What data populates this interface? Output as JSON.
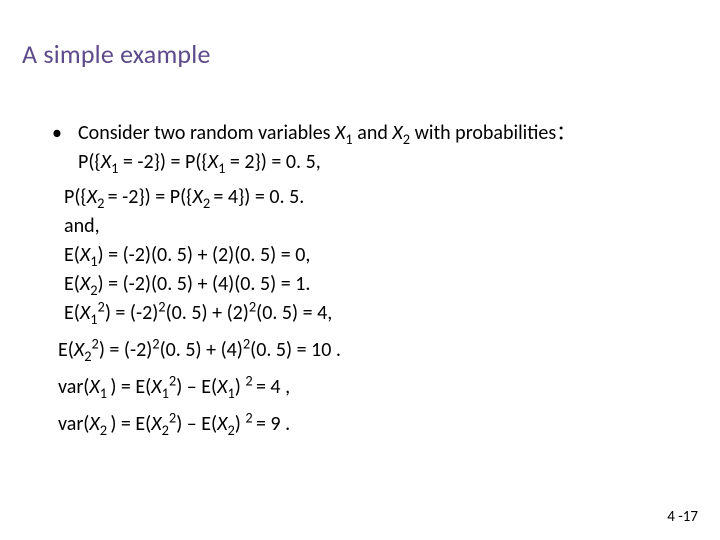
{
  "title": "A simple example",
  "bullet_dot": "•",
  "lead": {
    "part1": "Consider two random variables ",
    "x1": "X",
    "sub1": "1",
    "mid": " and  ",
    "x2": "X",
    "sub2": "2",
    "part2": " with probabilities：",
    "line2a": "P({",
    "line2x": "X",
    "line2s": "1",
    "line2b": " = -2}) = P({",
    "line2x2": "X",
    "line2s2": "1",
    "line2c": " = 2}) = 0. 5,"
  },
  "p2": {
    "a": "P({",
    "x": "X",
    "s": "2 ",
    "b": "= -2}) = P({",
    "x2": "X",
    "s2": "2 ",
    "c": "= 4}) = 0. 5."
  },
  "and": "and,",
  "e1": {
    "a": "E(",
    "x": "X",
    "s": "1",
    "b": ") = (-2)(0. 5) + (2)(0. 5) = 0,"
  },
  "e2": {
    "a": "E(",
    "x": "X",
    "s": "2",
    "b": ") = (-2)(0. 5) + (4)(0. 5) = 1."
  },
  "e3": {
    "a": "E(",
    "x": "X",
    "s": "1",
    "p": "2",
    "b": ") = (-2)",
    "p2": "2",
    "c": "(0. 5) + (2)",
    "p3": "2",
    "d": "(0. 5) = 4,"
  },
  "e4": {
    "a": "E(",
    "x": "X",
    "s": "2",
    "p": "2",
    "b": ") = (-2)",
    "p2": "2",
    "c": "(0. 5) + (4)",
    "p3": "2",
    "d": "(0. 5) = 10 ."
  },
  "v1": {
    "a": "var(",
    "x": "X",
    "s": "1 ",
    "b": ") = E(",
    "x2": "X",
    "s2": "1",
    "p": "2",
    "c": ") – E(",
    "x3": "X",
    "s3": "1",
    "d": ") ",
    "p2": "2 ",
    "e": "= 4 ,"
  },
  "v2": {
    "a": "var(",
    "x": "X",
    "s": "2 ",
    "b": ") = E(",
    "x2": "X",
    "s2": "2",
    "p": "2",
    "c": ") – E(",
    "x3": "X",
    "s3": "2",
    "d": ") ",
    "p2": "2 ",
    "e": "= 9 ."
  },
  "pagenum": "4 -17"
}
